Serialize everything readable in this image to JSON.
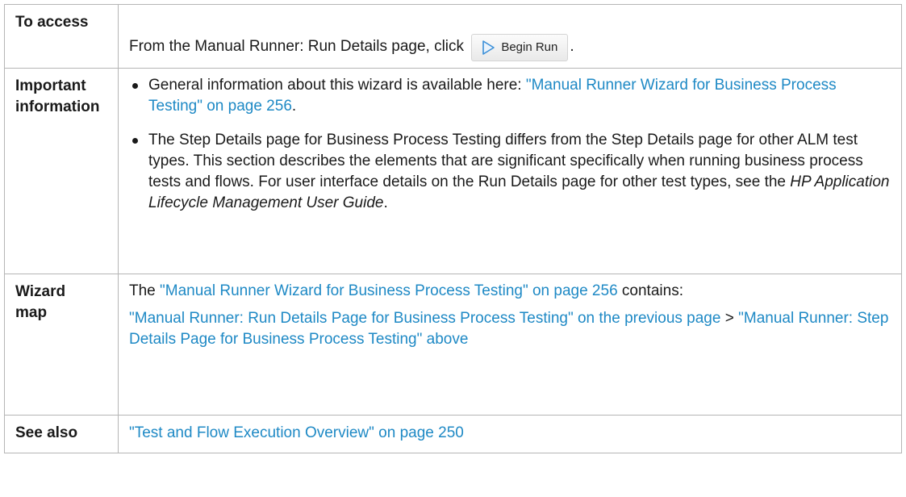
{
  "rows": {
    "access": {
      "label": "To access",
      "text_before": "From the Manual Runner: Run Details page, click",
      "button_label": "Begin Run",
      "text_after": "."
    },
    "important": {
      "label_line1": "Important",
      "label_line2": "information",
      "bullet1_text": "General information about this wizard is available here:",
      "bullet1_link": "\"Manual Runner Wizard for Business Process Testing\" on page 256",
      "bullet1_end": ".",
      "bullet2_text": "The Step Details page for Business Process Testing differs from the Step Details page for other ALM test types. This section describes the elements that are significant specifically when running business process tests and flows. For user interface details on the Run Details page for other test types, see the",
      "bullet2_guide": "HP Application Lifecycle Management User Guide",
      "bullet2_end": "."
    },
    "wizard_map": {
      "label_line1": "Wizard",
      "label_line2": "map",
      "intro_the": "The",
      "intro_link": "\"Manual Runner Wizard for Business Process Testing\" on page 256",
      "intro_end": "contains:",
      "path_link1": "\"Manual Runner: Run Details Page for Business Process Testing\" on the previous page",
      "path_sep": ">",
      "path_link2": "\"Manual Runner: Step Details Page for Business Process Testing\" above"
    },
    "see_also": {
      "label": "See also",
      "link": "\"Test and Flow Execution Overview\" on page 250"
    }
  },
  "colors": {
    "link": "#1e89c5",
    "border": "#b5b5b5",
    "play_icon": "#3a8fd8"
  }
}
